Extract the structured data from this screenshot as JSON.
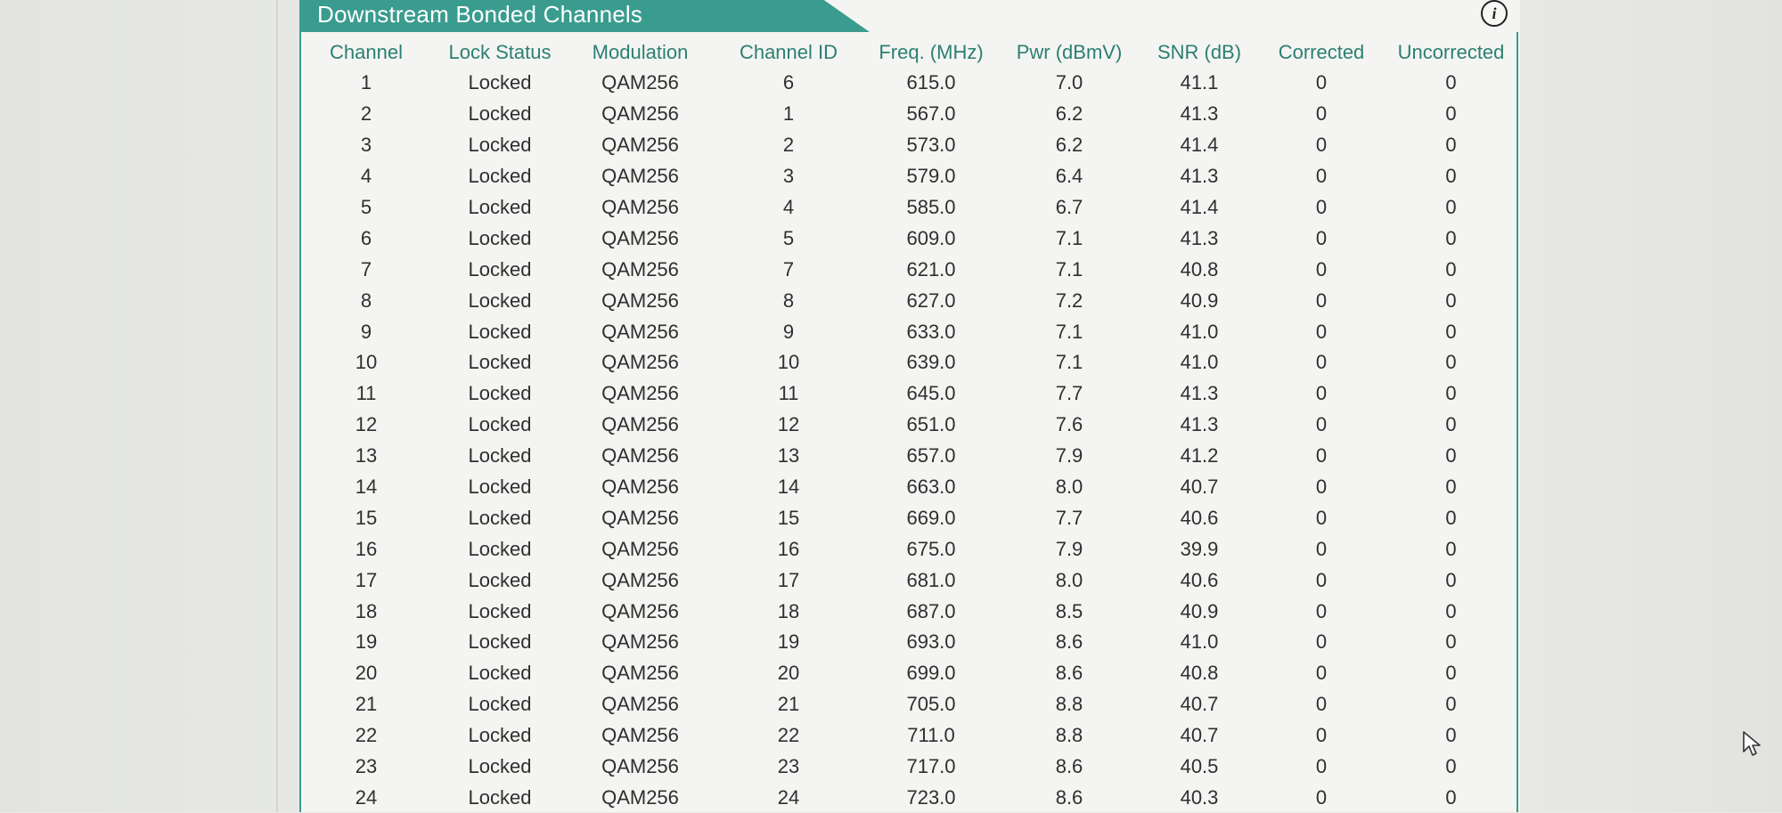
{
  "panel": {
    "title": "Downstream Bonded Channels",
    "info_icon": "info-icon"
  },
  "table": {
    "headers": [
      "Channel",
      "Lock Status",
      "Modulation",
      "Channel ID",
      "Freq. (MHz)",
      "Pwr (dBmV)",
      "SNR (dB)",
      "Corrected",
      "Uncorrected"
    ],
    "rows": [
      [
        "1",
        "Locked",
        "QAM256",
        "6",
        "615.0",
        "7.0",
        "41.1",
        "0",
        "0"
      ],
      [
        "2",
        "Locked",
        "QAM256",
        "1",
        "567.0",
        "6.2",
        "41.3",
        "0",
        "0"
      ],
      [
        "3",
        "Locked",
        "QAM256",
        "2",
        "573.0",
        "6.2",
        "41.4",
        "0",
        "0"
      ],
      [
        "4",
        "Locked",
        "QAM256",
        "3",
        "579.0",
        "6.4",
        "41.3",
        "0",
        "0"
      ],
      [
        "5",
        "Locked",
        "QAM256",
        "4",
        "585.0",
        "6.7",
        "41.4",
        "0",
        "0"
      ],
      [
        "6",
        "Locked",
        "QAM256",
        "5",
        "609.0",
        "7.1",
        "41.3",
        "0",
        "0"
      ],
      [
        "7",
        "Locked",
        "QAM256",
        "7",
        "621.0",
        "7.1",
        "40.8",
        "0",
        "0"
      ],
      [
        "8",
        "Locked",
        "QAM256",
        "8",
        "627.0",
        "7.2",
        "40.9",
        "0",
        "0"
      ],
      [
        "9",
        "Locked",
        "QAM256",
        "9",
        "633.0",
        "7.1",
        "41.0",
        "0",
        "0"
      ],
      [
        "10",
        "Locked",
        "QAM256",
        "10",
        "639.0",
        "7.1",
        "41.0",
        "0",
        "0"
      ],
      [
        "11",
        "Locked",
        "QAM256",
        "11",
        "645.0",
        "7.7",
        "41.3",
        "0",
        "0"
      ],
      [
        "12",
        "Locked",
        "QAM256",
        "12",
        "651.0",
        "7.6",
        "41.3",
        "0",
        "0"
      ],
      [
        "13",
        "Locked",
        "QAM256",
        "13",
        "657.0",
        "7.9",
        "41.2",
        "0",
        "0"
      ],
      [
        "14",
        "Locked",
        "QAM256",
        "14",
        "663.0",
        "8.0",
        "40.7",
        "0",
        "0"
      ],
      [
        "15",
        "Locked",
        "QAM256",
        "15",
        "669.0",
        "7.7",
        "40.6",
        "0",
        "0"
      ],
      [
        "16",
        "Locked",
        "QAM256",
        "16",
        "675.0",
        "7.9",
        "39.9",
        "0",
        "0"
      ],
      [
        "17",
        "Locked",
        "QAM256",
        "17",
        "681.0",
        "8.0",
        "40.6",
        "0",
        "0"
      ],
      [
        "18",
        "Locked",
        "QAM256",
        "18",
        "687.0",
        "8.5",
        "40.9",
        "0",
        "0"
      ],
      [
        "19",
        "Locked",
        "QAM256",
        "19",
        "693.0",
        "8.6",
        "41.0",
        "0",
        "0"
      ],
      [
        "20",
        "Locked",
        "QAM256",
        "20",
        "699.0",
        "8.6",
        "40.8",
        "0",
        "0"
      ],
      [
        "21",
        "Locked",
        "QAM256",
        "21",
        "705.0",
        "8.8",
        "40.7",
        "0",
        "0"
      ],
      [
        "22",
        "Locked",
        "QAM256",
        "22",
        "711.0",
        "8.8",
        "40.7",
        "0",
        "0"
      ],
      [
        "23",
        "Locked",
        "QAM256",
        "23",
        "717.0",
        "8.6",
        "40.5",
        "0",
        "0"
      ],
      [
        "24",
        "Locked",
        "QAM256",
        "24",
        "723.0",
        "8.6",
        "40.3",
        "0",
        "0"
      ]
    ]
  },
  "cursor": {
    "icon": "mouse-pointer-icon"
  },
  "colors": {
    "accent": "#3a9c8e",
    "header_text": "#2b7f73",
    "cell_text": "#2f2f2f"
  }
}
